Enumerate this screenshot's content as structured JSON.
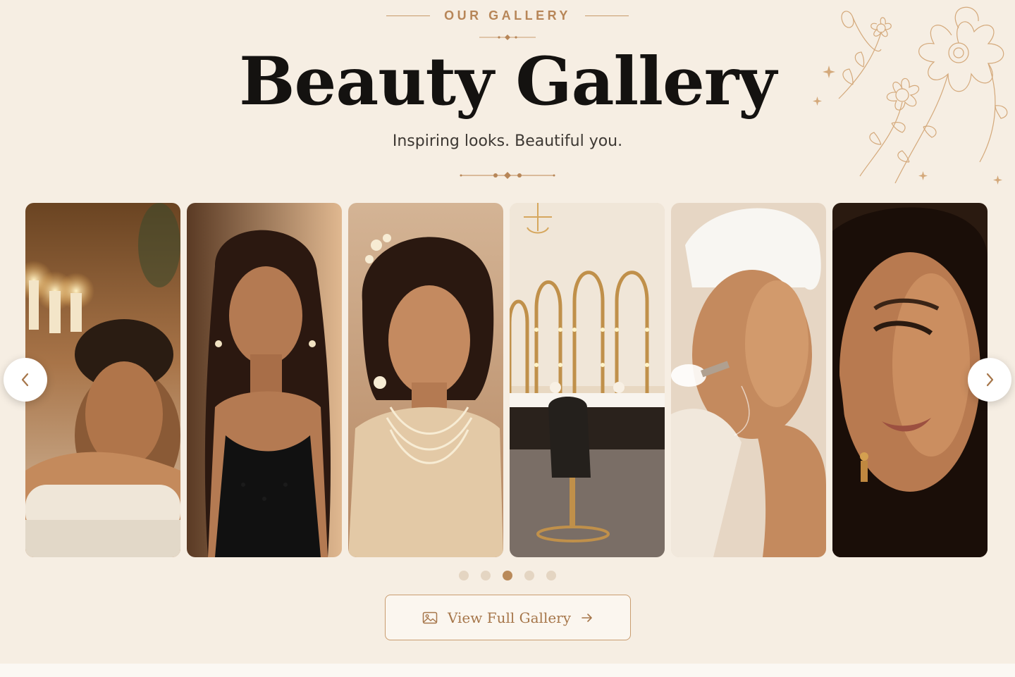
{
  "section": {
    "eyebrow": "OUR GALLERY",
    "title": "Beauty Gallery",
    "subtitle": "Inspiring looks. Beautiful you."
  },
  "gallery": {
    "images": [
      {
        "name": "spa-massage-photo"
      },
      {
        "name": "evening-glam-photo"
      },
      {
        "name": "bridal-look-photo"
      },
      {
        "name": "salon-interior-photo"
      },
      {
        "name": "facial-treatment-photo"
      },
      {
        "name": "makeup-closeup-photo"
      }
    ],
    "prev_icon": "chevron-left-icon",
    "next_icon": "chevron-right-icon",
    "dots_count": 5,
    "active_dot": 3
  },
  "cta": {
    "label": "View Full Gallery",
    "icon": "image-icon",
    "arrow_icon": "arrow-right-icon"
  },
  "colors": {
    "background": "#f6eee3",
    "accent": "#b78658",
    "title": "#141210"
  }
}
